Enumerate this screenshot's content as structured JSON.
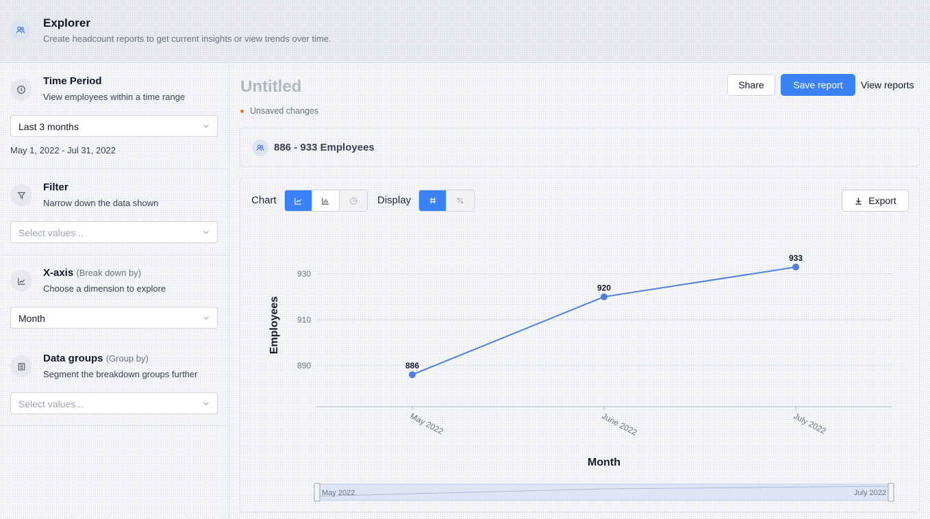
{
  "header": {
    "title": "Explorer",
    "subtitle": "Create headcount reports to get current insights or view trends over time.",
    "icon": "people-icon"
  },
  "sidebar": {
    "time_period": {
      "title": "Time Period",
      "description": "View employees within a time range",
      "select_value": "Last 3 months",
      "range": "May 1, 2022 - Jul 31, 2022",
      "icon": "clock-icon"
    },
    "filter": {
      "title": "Filter",
      "description": "Narrow down the data shown",
      "placeholder": "Select values...",
      "icon": "funnel-icon"
    },
    "x_axis": {
      "title": "X-axis",
      "title_hint": "(Break down by)",
      "description": "Choose a dimension to explore",
      "select_value": "Month",
      "icon": "line-chart-icon"
    },
    "data_groups": {
      "title": "Data groups",
      "title_hint": "(Group by)",
      "description": "Segment the breakdown groups further",
      "placeholder": "Select values...",
      "icon": "layers-icon"
    }
  },
  "report": {
    "title": "Untitled",
    "status": "Unsaved changes",
    "share_label": "Share",
    "save_label": "Save report",
    "view_label": "View reports",
    "summary": "886 - 933 Employees"
  },
  "controls": {
    "chart_label": "Chart",
    "display_label": "Display",
    "export_label": "Export",
    "chart_types": [
      "line-chart-icon",
      "bar-chart-icon",
      "pie-chart-icon"
    ],
    "chart_active": "line",
    "display_modes": [
      "hash-icon",
      "percent-icon"
    ],
    "display_active": "number"
  },
  "colors": {
    "accent": "#3b82f6",
    "line": "#4f7fe0",
    "status_dot": "#f97316"
  },
  "chart_data": {
    "type": "line",
    "categories": [
      "May 2022",
      "June 2022",
      "July 2022"
    ],
    "values": [
      886,
      920,
      933
    ],
    "xlabel": "Month",
    "ylabel": "Employees",
    "ylim": [
      872,
      936
    ],
    "yticks": [
      890,
      910,
      930
    ],
    "grid": true,
    "range_slider": {
      "start_label": "May 2022",
      "end_label": "July 2022"
    }
  }
}
